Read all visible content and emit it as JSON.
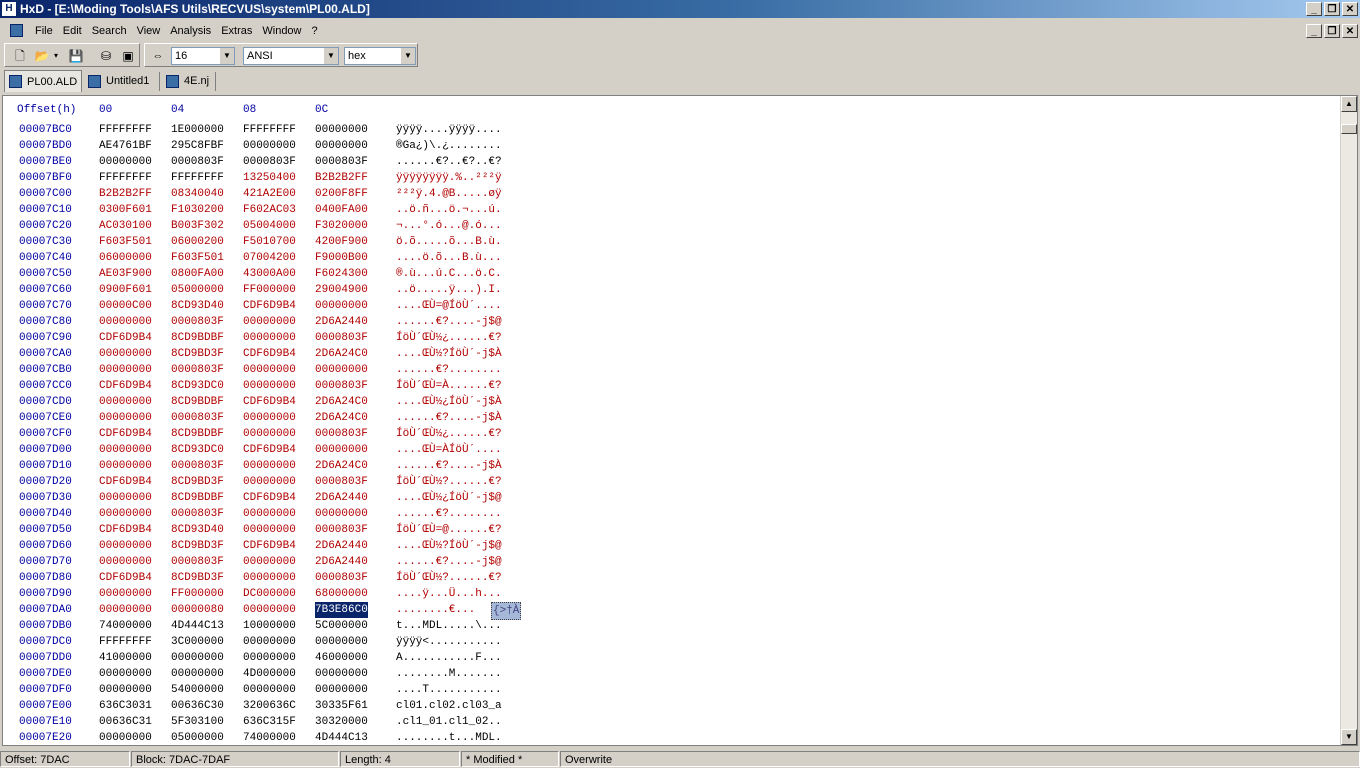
{
  "window": {
    "title": "HxD - [E:\\Moding Tools\\AFS Utils\\RECVUS\\system\\PL00.ALD]",
    "app_icon": "hxd-icon",
    "controls": [
      "_",
      "❐",
      "✕"
    ]
  },
  "menu": {
    "items": [
      "File",
      "Edit",
      "Search",
      "View",
      "Analysis",
      "Extras",
      "Window",
      "?"
    ]
  },
  "toolbar": {
    "bytes_per_row": "16",
    "charset": "ANSI",
    "mode": "hex"
  },
  "tabs": [
    "PL00.ALD",
    "Untitled1",
    "4E.nj"
  ],
  "hex": {
    "header": {
      "offset": "Offset(h)",
      "c0": "00",
      "c1": "04",
      "c2": "08",
      "c3": "0C"
    },
    "rows": [
      {
        "off": "00007BC0",
        "g": [
          "FFFFFFFF",
          "1E000000",
          "FFFFFFFF",
          "00000000"
        ],
        "asc": "ÿÿÿÿ....ÿÿÿÿ....",
        "mod": false
      },
      {
        "off": "00007BD0",
        "g": [
          "AE4761BF",
          "295C8FBF",
          "00000000",
          "00000000"
        ],
        "asc": "®Ga¿)\\.¿........",
        "mod": false
      },
      {
        "off": "00007BE0",
        "g": [
          "00000000",
          "0000803F",
          "0000803F",
          "0000803F"
        ],
        "asc": "......€?..€?..€?",
        "mod": false
      },
      {
        "off": "00007BF0",
        "g": [
          "FFFFFFFF",
          "FFFFFFFF",
          "13250400",
          "B2B2B2FF"
        ],
        "asc": "ÿÿÿÿÿÿÿÿ.%..²²²ÿ",
        "mod": true,
        "plain_cols": 2
      },
      {
        "off": "00007C00",
        "g": [
          "B2B2B2FF",
          "08340040",
          "421A2E00",
          "0200F8FF"
        ],
        "asc": "²²²ÿ.4.@B.....øÿ",
        "mod": true
      },
      {
        "off": "00007C10",
        "g": [
          "0300F601",
          "F1030200",
          "F602AC03",
          "0400FA00"
        ],
        "asc": "..ö.ñ...ö.¬...ú.",
        "mod": true
      },
      {
        "off": "00007C20",
        "g": [
          "AC030100",
          "B003F302",
          "05004000",
          "F3020000"
        ],
        "asc": "¬...°.ó...@.ó...",
        "mod": true
      },
      {
        "off": "00007C30",
        "g": [
          "F603F501",
          "06000200",
          "F5010700",
          "4200F900"
        ],
        "asc": "ö.õ.....õ...B.ù.",
        "mod": true
      },
      {
        "off": "00007C40",
        "g": [
          "06000000",
          "F603F501",
          "07004200",
          "F9000B00"
        ],
        "asc": "....ö.õ...B.ù...",
        "mod": true
      },
      {
        "off": "00007C50",
        "g": [
          "AE03F900",
          "0800FA00",
          "43000A00",
          "F6024300"
        ],
        "asc": "®.ù...ú.C...ö.C.",
        "mod": true
      },
      {
        "off": "00007C60",
        "g": [
          "0900F601",
          "05000000",
          "FF000000",
          "29004900"
        ],
        "asc": "..ö.....ÿ...).I.",
        "mod": true
      },
      {
        "off": "00007C70",
        "g": [
          "00000C00",
          "8CD93D40",
          "CDF6D9B4",
          "00000000"
        ],
        "asc": "....ŒÙ=@ÍöÙ´....",
        "mod": true
      },
      {
        "off": "00007C80",
        "g": [
          "00000000",
          "0000803F",
          "00000000",
          "2D6A2440"
        ],
        "asc": "......€?....-j$@",
        "mod": true
      },
      {
        "off": "00007C90",
        "g": [
          "CDF6D9B4",
          "8CD9BDBF",
          "00000000",
          "0000803F"
        ],
        "asc": "ÍöÙ´ŒÙ½¿......€?",
        "mod": true
      },
      {
        "off": "00007CA0",
        "g": [
          "00000000",
          "8CD9BD3F",
          "CDF6D9B4",
          "2D6A24C0"
        ],
        "asc": "....ŒÙ½?ÍöÙ´-j$À",
        "mod": true
      },
      {
        "off": "00007CB0",
        "g": [
          "00000000",
          "0000803F",
          "00000000",
          "00000000"
        ],
        "asc": "......€?........",
        "mod": true
      },
      {
        "off": "00007CC0",
        "g": [
          "CDF6D9B4",
          "8CD93DC0",
          "00000000",
          "0000803F"
        ],
        "asc": "ÍöÙ´ŒÙ=À......€?",
        "mod": true
      },
      {
        "off": "00007CD0",
        "g": [
          "00000000",
          "8CD9BDBF",
          "CDF6D9B4",
          "2D6A24C0"
        ],
        "asc": "....ŒÙ½¿ÍöÙ´-j$À",
        "mod": true
      },
      {
        "off": "00007CE0",
        "g": [
          "00000000",
          "0000803F",
          "00000000",
          "2D6A24C0"
        ],
        "asc": "......€?....-j$À",
        "mod": true
      },
      {
        "off": "00007CF0",
        "g": [
          "CDF6D9B4",
          "8CD9BDBF",
          "00000000",
          "0000803F"
        ],
        "asc": "ÍöÙ´ŒÙ½¿......€?",
        "mod": true
      },
      {
        "off": "00007D00",
        "g": [
          "00000000",
          "8CD93DC0",
          "CDF6D9B4",
          "00000000"
        ],
        "asc": "....ŒÙ=ÀÍöÙ´....",
        "mod": true
      },
      {
        "off": "00007D10",
        "g": [
          "00000000",
          "0000803F",
          "00000000",
          "2D6A24C0"
        ],
        "asc": "......€?....-j$À",
        "mod": true
      },
      {
        "off": "00007D20",
        "g": [
          "CDF6D9B4",
          "8CD9BD3F",
          "00000000",
          "0000803F"
        ],
        "asc": "ÍöÙ´ŒÙ½?......€?",
        "mod": true
      },
      {
        "off": "00007D30",
        "g": [
          "00000000",
          "8CD9BDBF",
          "CDF6D9B4",
          "2D6A2440"
        ],
        "asc": "....ŒÙ½¿ÍöÙ´-j$@",
        "mod": true
      },
      {
        "off": "00007D40",
        "g": [
          "00000000",
          "0000803F",
          "00000000",
          "00000000"
        ],
        "asc": "......€?........",
        "mod": true
      },
      {
        "off": "00007D50",
        "g": [
          "CDF6D9B4",
          "8CD93D40",
          "00000000",
          "0000803F"
        ],
        "asc": "ÍöÙ´ŒÙ=@......€?",
        "mod": true
      },
      {
        "off": "00007D60",
        "g": [
          "00000000",
          "8CD9BD3F",
          "CDF6D9B4",
          "2D6A2440"
        ],
        "asc": "....ŒÙ½?ÍöÙ´-j$@",
        "mod": true
      },
      {
        "off": "00007D70",
        "g": [
          "00000000",
          "0000803F",
          "00000000",
          "2D6A2440"
        ],
        "asc": "......€?....-j$@",
        "mod": true
      },
      {
        "off": "00007D80",
        "g": [
          "CDF6D9B4",
          "8CD9BD3F",
          "00000000",
          "0000803F"
        ],
        "asc": "ÍöÙ´ŒÙ½?......€?",
        "mod": true
      },
      {
        "off": "00007D90",
        "g": [
          "00000000",
          "FF000000",
          "DC000000",
          "68000000"
        ],
        "asc": "....ÿ...Ü...h...",
        "mod": true
      },
      {
        "off": "00007DA0",
        "g": [
          "00000000",
          "00000080",
          "00000000",
          "7B3E86C0"
        ],
        "asc": "........€...",
        "asc_sel": "{>†À",
        "mod": true,
        "sel_col": 3
      },
      {
        "off": "00007DB0",
        "g": [
          "74000000",
          "4D444C13",
          "10000000",
          "5C000000"
        ],
        "asc": "t...MDL.....\\...",
        "mod": false
      },
      {
        "off": "00007DC0",
        "g": [
          "FFFFFFFF",
          "3C000000",
          "00000000",
          "00000000"
        ],
        "asc": "ÿÿÿÿ<...........",
        "mod": false
      },
      {
        "off": "00007DD0",
        "g": [
          "41000000",
          "00000000",
          "00000000",
          "46000000"
        ],
        "asc": "A...........F...",
        "mod": false
      },
      {
        "off": "00007DE0",
        "g": [
          "00000000",
          "00000000",
          "4D000000",
          "00000000"
        ],
        "asc": "........M.......",
        "mod": false
      },
      {
        "off": "00007DF0",
        "g": [
          "00000000",
          "54000000",
          "00000000",
          "00000000"
        ],
        "asc": "....T...........",
        "mod": false
      },
      {
        "off": "00007E00",
        "g": [
          "636C3031",
          "00636C30",
          "3200636C",
          "30335F61"
        ],
        "asc": "cl01.cl02.cl03_a",
        "mod": false
      },
      {
        "off": "00007E10",
        "g": [
          "00636C31",
          "5F303100",
          "636C315F",
          "30320000"
        ],
        "asc": ".cl1_01.cl1_02..",
        "mod": false
      },
      {
        "off": "00007E20",
        "g": [
          "00000000",
          "05000000",
          "74000000",
          "4D444C13"
        ],
        "asc": "........t...MDL.",
        "mod": false
      }
    ]
  },
  "status": {
    "offset": "Offset: 7DAC",
    "block": "Block: 7DAC-7DAF",
    "length": "Length: 4",
    "modified": "* Modified *",
    "mode": "Overwrite"
  }
}
